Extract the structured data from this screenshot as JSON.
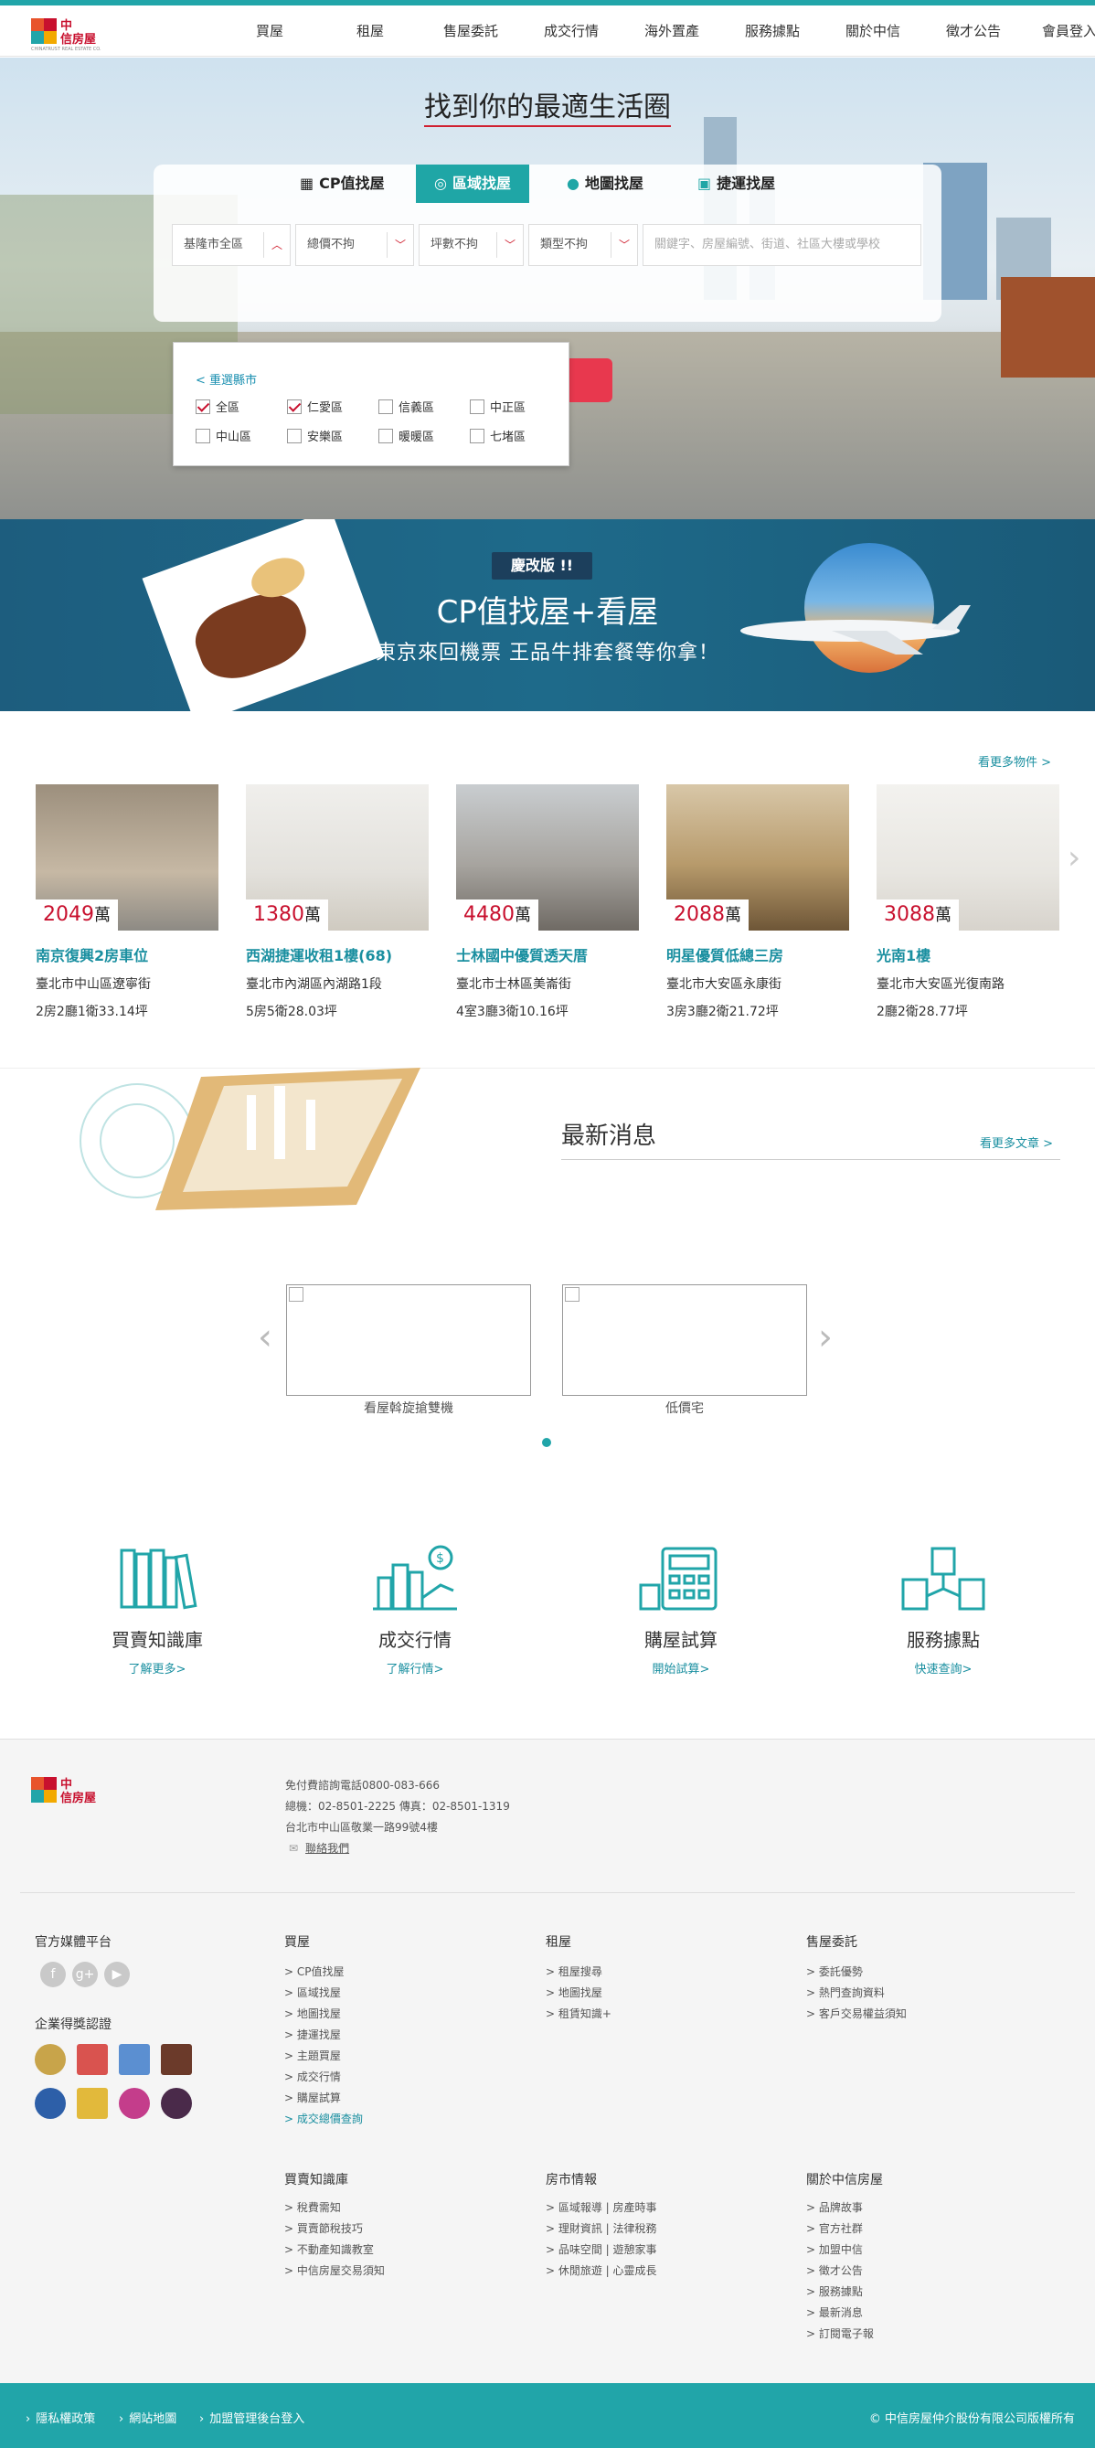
{
  "nav": [
    "買屋",
    "租屋",
    "售屋委託",
    "成交行情",
    "海外置產",
    "服務據點",
    "關於中信",
    "徵才公告",
    "會員登入"
  ],
  "logo": {
    "name": "中信房屋",
    "en": "CHINATRUST REAL ESTATE CO."
  },
  "hero": {
    "title": "找到你的最適生活圈",
    "tabs": [
      "CP值找屋",
      "區域找屋",
      "地圖找屋",
      "捷運找屋"
    ],
    "selects": [
      "基隆市全區",
      "總價不拘",
      "坪數不拘",
      "類型不拘"
    ],
    "keyword_placeholder": "關鍵字、房屋編號、街道、社區大樓或學校",
    "dropdown": {
      "reselect": "< 重選縣市",
      "districts": [
        {
          "label": "全區",
          "checked": true
        },
        {
          "label": "仁愛區",
          "checked": true
        },
        {
          "label": "信義區",
          "checked": false
        },
        {
          "label": "中正區",
          "checked": false
        },
        {
          "label": "中山區",
          "checked": false
        },
        {
          "label": "安樂區",
          "checked": false
        },
        {
          "label": "暖暖區",
          "checked": false
        },
        {
          "label": "七堵區",
          "checked": false
        }
      ]
    }
  },
  "banner": {
    "badge": "慶改版 !!",
    "title": "CP值找屋+看屋",
    "subtitle": "東京來回機票  王品牛排套餐等你拿！"
  },
  "listings": {
    "more": "看更多物件 >",
    "items": [
      {
        "price": "2049",
        "unit": "萬",
        "title": "南京復興2房車位",
        "addr": "臺北市中山區遼寧街",
        "layout": "2房2廳1衛33.14坪"
      },
      {
        "price": "1380",
        "unit": "萬",
        "title": "西湖捷運收租1樓(68)",
        "addr": "臺北市內湖區內湖路1段",
        "layout": "5房5衛28.03坪"
      },
      {
        "price": "4480",
        "unit": "萬",
        "title": "士林國中優質透天厝",
        "addr": "臺北市士林區美崙街",
        "layout": "4室3廳3衛10.16坪"
      },
      {
        "price": "2088",
        "unit": "萬",
        "title": "明星優質低總三房",
        "addr": "臺北市大安區永康街",
        "layout": "3房3廳2衛21.72坪"
      },
      {
        "price": "3088",
        "unit": "萬",
        "title": "光南1樓",
        "addr": "臺北市大安區光復南路",
        "layout": "2廳2衛28.77坪"
      }
    ]
  },
  "news": {
    "title": "最新消息",
    "more": "看更多文章 >",
    "slides": [
      "看屋斡旋搶雙機",
      "低價宅"
    ]
  },
  "services": [
    {
      "name": "買賣知識庫",
      "more": "了解更多>"
    },
    {
      "name": "成交行情",
      "more": "了解行情>"
    },
    {
      "name": "購屋試算",
      "more": "開始試算>"
    },
    {
      "name": "服務據點",
      "more": "快速查詢>"
    }
  ],
  "footer": {
    "info": [
      "免付費諮詢電話0800-083-666",
      "總機：02-8501-2225   傳真：02-8501-1319",
      "台北市中山區敬業一路99號4樓",
      "聯絡我們"
    ],
    "social_title": "官方媒體平台",
    "awards_title": "企業得獎認證",
    "social": [
      "f",
      "g+",
      "▶"
    ],
    "cols": [
      {
        "title": "買屋",
        "links": [
          "> CP值找屋",
          "> 區域找屋",
          "> 地圖找屋",
          "> 捷運找屋",
          "> 主題買屋",
          "> 成交行情",
          "> 購屋試算",
          "> 成交總價查詢"
        ]
      },
      {
        "title": "租屋",
        "links": [
          "> 租屋搜尋",
          "> 地圖找屋",
          "> 租賃知識+"
        ]
      },
      {
        "title": "售屋委託",
        "links": [
          "> 委託優勢",
          "> 熱門查詢資料",
          "> 客戶交易權益須知"
        ]
      },
      {
        "title": "買賣知識庫",
        "links": [
          "> 稅費需知",
          "> 買賣節稅技巧",
          "> 不動產知識教室",
          "> 中信房屋交易須知"
        ]
      },
      {
        "title": "房市情報",
        "links": [
          "> 區域報導 | 房產時事",
          "> 理財資訊 | 法律稅務",
          "> 品味空間 | 遊憩家事",
          "> 休閒旅遊 | 心靈成長"
        ]
      },
      {
        "title": "關於中信房屋",
        "links": [
          "> 品牌故事",
          "> 官方社群",
          "> 加盟中信",
          "> 徵才公告",
          "> 服務據點",
          "> 最新消息",
          "> 訂閱電子報"
        ]
      }
    ]
  },
  "bottom": {
    "links": [
      "隱私權政策",
      "網站地圖",
      "加盟管理後台登入"
    ],
    "copyright": "© 中信房屋仲介股份有限公司版權所有"
  }
}
